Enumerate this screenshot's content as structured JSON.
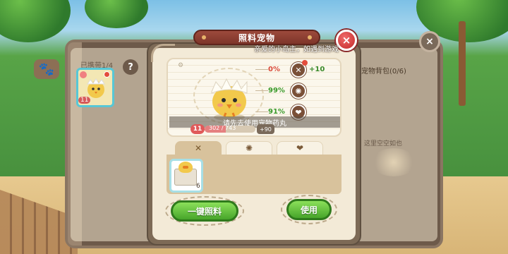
{
  "dialog": {
    "title": "照料宠物",
    "greeting": "亲爱的小岛主，如遇到游戏",
    "close_icon": "×"
  },
  "pet": {
    "hint": "请先去使用宠物药丸",
    "level": "11",
    "exp_text": "302 / 743",
    "exp_fraction": 0.41,
    "exp_bonus": "+90"
  },
  "stats": [
    {
      "name": "hunger",
      "percent": "0%",
      "icon": "fork-spoon-icon",
      "glyph": "✕",
      "bonus": "+10",
      "color": "#d94a3a"
    },
    {
      "name": "clean",
      "percent": "99%",
      "icon": "sparkle-icon",
      "glyph": "✺",
      "bonus": "",
      "color": "#3a9a2a"
    },
    {
      "name": "mood",
      "percent": "91%",
      "icon": "heart-icon",
      "glyph": "❤",
      "bonus": "",
      "color": "#3a9a2a"
    }
  ],
  "tabs": [
    {
      "name": "food",
      "glyph": "✕",
      "active": true
    },
    {
      "name": "clean",
      "glyph": "✺",
      "active": false
    },
    {
      "name": "mood",
      "glyph": "❤",
      "active": false
    }
  ],
  "items": [
    {
      "name": "chick-food",
      "count": "6"
    }
  ],
  "buttons": {
    "feed_all": "一键照料",
    "use": "使用"
  },
  "back_panel": {
    "carried_label": "已携带1/4",
    "pet_card_level": "11",
    "help_icon": "?",
    "bag_title": "宠物背包(0/6)",
    "bag_empty": "这里空空如也",
    "paw_icon": "🐾",
    "close_icon": "×"
  }
}
